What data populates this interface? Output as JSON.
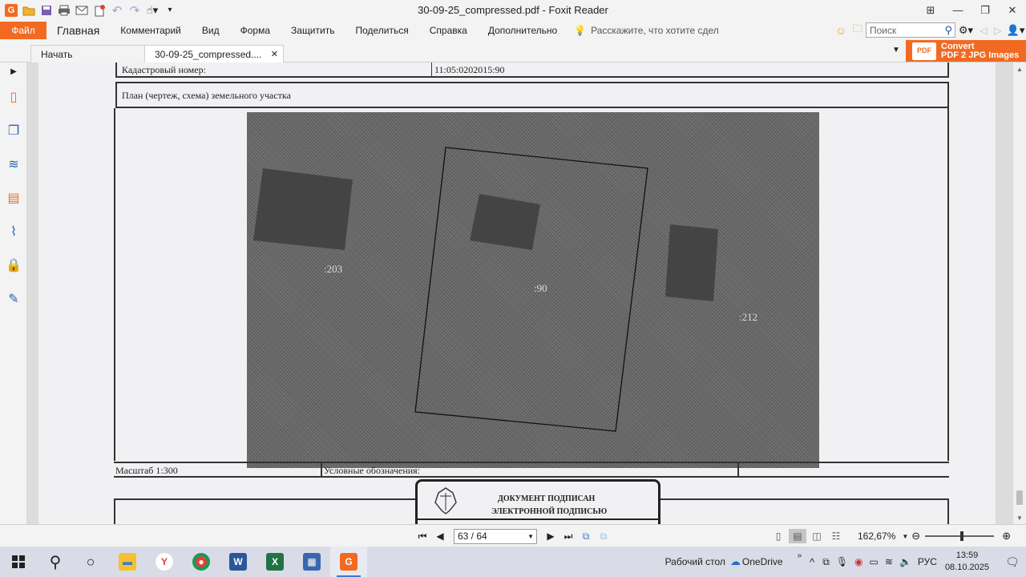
{
  "window": {
    "title": "30-09-25_compressed.pdf - Foxit Reader"
  },
  "ribbon": {
    "file_label": "Файл",
    "tabs": [
      "Главная",
      "Комментарий",
      "Вид",
      "Форма",
      "Защитить",
      "Поделиться",
      "Справка",
      "Дополнительно"
    ],
    "tell_me": "Расскажите, что хотите сдел",
    "search_placeholder": "Поиск"
  },
  "doc_tabs": {
    "start": "Начать",
    "active": "30-09-25_compressed....",
    "close": "✕"
  },
  "convert_ad": {
    "line1": "Convert",
    "line2": "PDF 2 JPG Images",
    "icon_text": "PDF"
  },
  "document": {
    "cadastral_label": "Кадастровый номер:",
    "cadastral_value": "11:05:0202015:90",
    "plan_title": "План (чертеж, схема) земельного участка",
    "parcels": {
      "left": ":203",
      "center": ":90",
      "right": ":212"
    },
    "scale": "Масштаб 1:300",
    "legend_label": "Условные обозначения:",
    "stamp_line1": "ДОКУМЕНТ ПОДПИСАН",
    "stamp_line2": "ЭЛЕКТРОННОЙ ПОДПИСЬЮ"
  },
  "statusbar": {
    "page_value": "63 / 64",
    "zoom": "162,67%",
    "zoom_fraction": 0.54
  },
  "taskbar": {
    "desktop_label": "Рабочий стол",
    "onedrive_label": "OneDrive",
    "language": "РУС",
    "time": "13:59",
    "date": "08.10.2025"
  }
}
